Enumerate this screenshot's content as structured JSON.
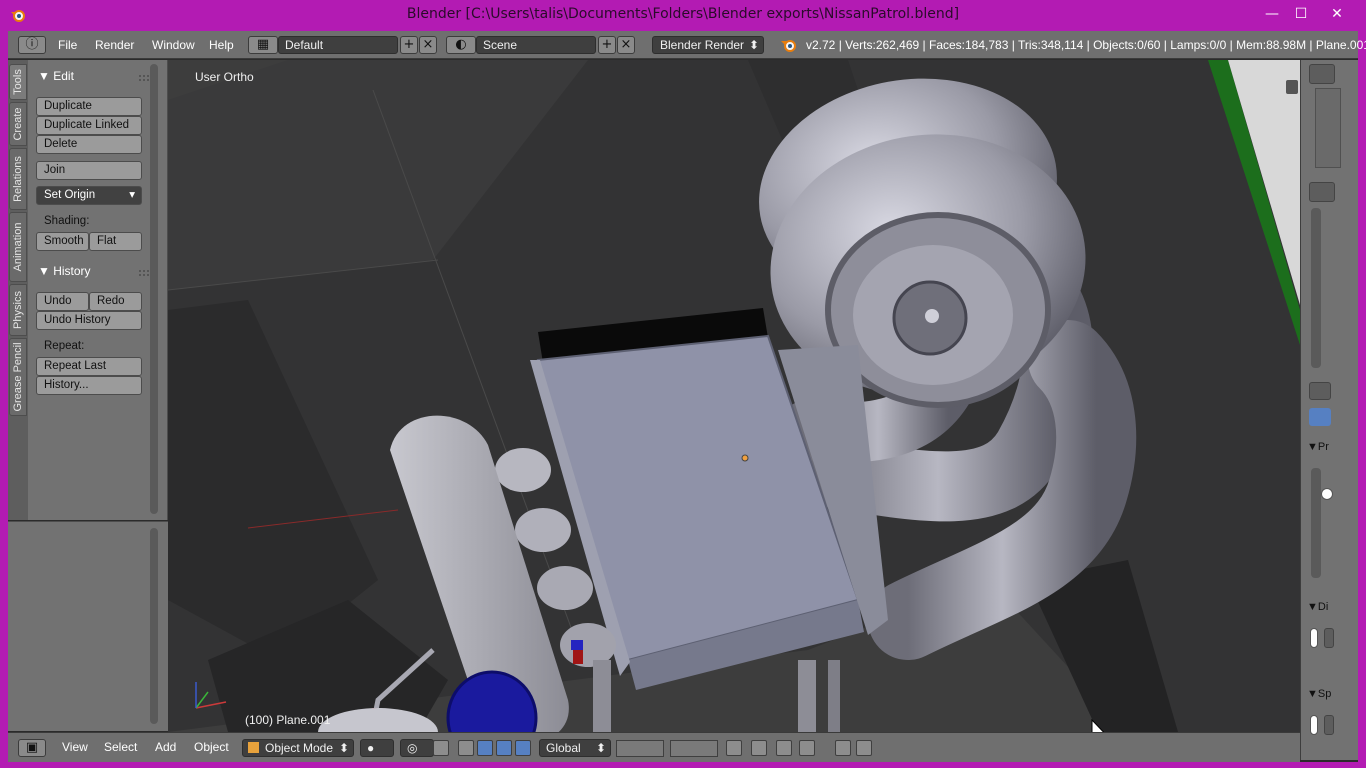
{
  "window": {
    "title": "Blender [C:\\Users\\talis\\Documents\\Folders\\Blender exports\\NissanPatrol.blend]",
    "minimize": "—",
    "maximize": "☐",
    "close": "✕"
  },
  "info_header": {
    "menus": [
      "File",
      "Render",
      "Window",
      "Help"
    ],
    "layout": "Default",
    "scene": "Scene",
    "render_engine": "Blender Render",
    "stats": "v2.72 | Verts:262,469 | Faces:184,783 | Tris:348,114 | Objects:0/60 | Lamps:0/0 | Mem:88.98M | Plane.001"
  },
  "tool_tabs": [
    "Tools",
    "Create",
    "Relations",
    "Animation",
    "Physics",
    "Grease Pencil"
  ],
  "tool_shelf": {
    "edit_panel": {
      "title": "Edit",
      "buttons": [
        "Duplicate",
        "Duplicate Linked",
        "Delete",
        "Join"
      ],
      "set_origin": "Set Origin",
      "shading_label": "Shading:",
      "smooth": "Smooth",
      "flat": "Flat"
    },
    "history_panel": {
      "title": "History",
      "undo": "Undo",
      "redo": "Redo",
      "undo_history": "Undo History",
      "repeat_label": "Repeat:",
      "repeat_last": "Repeat Last",
      "history": "History..."
    }
  },
  "viewport": {
    "view_name": "User Ortho",
    "object_info": "(100) Plane.001"
  },
  "properties": {
    "sections": [
      "Pr",
      "Di",
      "Sp"
    ]
  },
  "bottom_header": {
    "menus": [
      "View",
      "Select",
      "Add",
      "Object"
    ],
    "mode": "Object Mode",
    "orientation": "Global"
  },
  "colors": {
    "window_frame": "#b31bb3",
    "header": "#6f6f6f",
    "panel": "#727272",
    "viewport_bg": "#3d3d3d",
    "accent_blue": "#5680c2",
    "object_blue": "#1a1a9e"
  }
}
